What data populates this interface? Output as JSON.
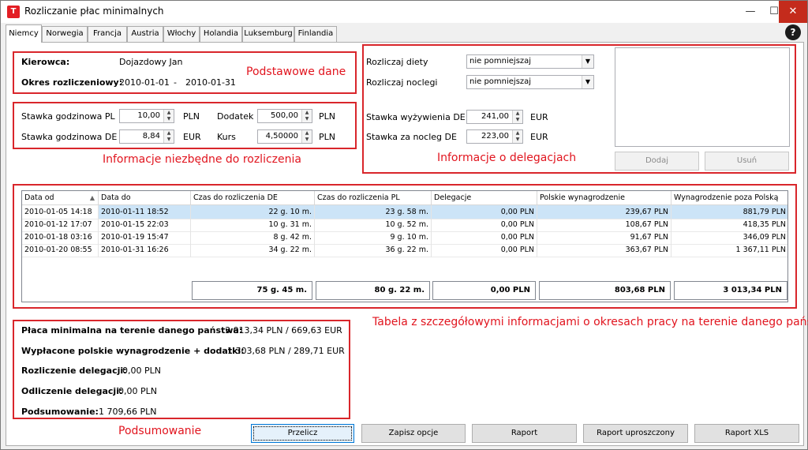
{
  "window": {
    "title": "Rozliczanie płac minimalnych",
    "minimize": "—",
    "maximize": "☐",
    "close": "✕",
    "app_icon": "T"
  },
  "tabs": [
    "Niemcy",
    "Norwegia",
    "Francja",
    "Austria",
    "Włochy",
    "Holandia",
    "Luksemburg",
    "Finlandia"
  ],
  "help_label": "?",
  "basic": {
    "driver_label": "Kierowca:",
    "driver_value": "Dojazdowy Jan",
    "period_label": "Okres rozliczeniowy:",
    "period_from": "2010-01-01",
    "period_sep": "-",
    "period_to": "2010-01-31",
    "annotation": "Podstawowe dane"
  },
  "rates": {
    "pl_label": "Stawka godzinowa PL",
    "pl_value": "10,00",
    "pl_unit": "PLN",
    "bonus_label": "Dodatek",
    "bonus_value": "500,00",
    "bonus_unit": "PLN",
    "de_label": "Stawka godzinowa DE",
    "de_value": "8,84",
    "de_unit": "EUR",
    "rate_label": "Kurs",
    "rate_value": "4,50000",
    "rate_unit": "PLN",
    "annotation": "Informacje niezbędne do rozliczenia"
  },
  "delegation": {
    "diets_label": "Rozliczaj diety",
    "diets_value": "nie pomniejszaj",
    "nights_label": "Rozliczaj noclegi",
    "nights_value": "nie pomniejszaj",
    "food_label": "Stawka wyżywienia DE",
    "food_value": "241,00",
    "food_unit": "EUR",
    "night_label": "Stawka za nocleg DE",
    "night_value": "223,00",
    "night_unit": "EUR",
    "add_label": "Dodaj",
    "remove_label": "Usuń",
    "annotation": "Informacje o delegacjach"
  },
  "table": {
    "columns": [
      "Data od",
      "Data do",
      "Czas do rozliczenia DE",
      "Czas do rozliczenia PL",
      "Delegacje",
      "Polskie wynagrodzenie",
      "Wynagrodzenie poza Polską"
    ],
    "rows": [
      [
        "2010-01-05 14:18",
        "2010-01-11 18:52",
        "22 g. 10 m.",
        "23 g. 58 m.",
        "0,00 PLN",
        "239,67 PLN",
        "881,79 PLN"
      ],
      [
        "2010-01-12 17:07",
        "2010-01-15 22:03",
        "10 g. 31 m.",
        "10 g. 52 m.",
        "0,00 PLN",
        "108,67 PLN",
        "418,35 PLN"
      ],
      [
        "2010-01-18 03:16",
        "2010-01-19 15:47",
        "8 g. 42 m.",
        "9 g. 10 m.",
        "0,00 PLN",
        "91,67 PLN",
        "346,09 PLN"
      ],
      [
        "2010-01-20 08:55",
        "2010-01-31 16:26",
        "34 g. 22 m.",
        "36 g. 22 m.",
        "0,00 PLN",
        "363,67 PLN",
        "1 367,11 PLN"
      ]
    ],
    "totals": [
      "75 g. 45 m.",
      "80 g. 22 m.",
      "0,00 PLN",
      "803,68 PLN",
      "3 013,34 PLN"
    ],
    "annotation": "Tabela z szczegółowymi informacjami o okresach pracy na terenie danego państwa"
  },
  "summary": {
    "min_wage_label": "Płaca minimalna na terenie danego państwa:",
    "min_wage_value": "3 013,34 PLN  /  669,63 EUR",
    "paid_label": "Wypłacone polskie wynagrodzenie + dodatki:",
    "paid_value": "1 303,68 PLN  /   289,71 EUR",
    "deleg_label": "Rozliczenie delegacji:",
    "deleg_value": "0,00 PLN",
    "deduct_label": "Odliczenie delegacji:",
    "deduct_value": "0,00 PLN",
    "total_label": "Podsumowanie:",
    "total_value": "1 709,66 PLN",
    "annotation": "Podsumowanie"
  },
  "buttons": {
    "recalc": "Przelicz",
    "save": "Zapisz opcje",
    "report": "Raport",
    "report_simple": "Raport uproszczony",
    "report_xls": "Raport XLS"
  },
  "colors": {
    "annotation_red": "#d9262b",
    "selection": "#cce4f7",
    "close_red": "#c42b1c"
  }
}
